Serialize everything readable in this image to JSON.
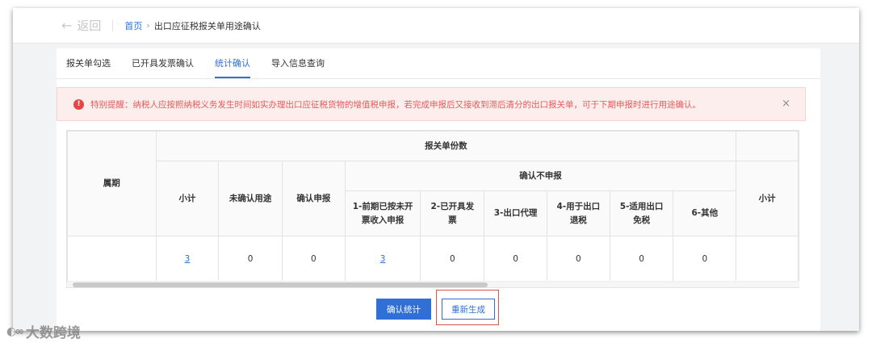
{
  "topbar": {
    "back_label": "返回",
    "breadcrumb_home": "首页",
    "breadcrumb_current": "出口应征税报关单用途确认"
  },
  "tabs": [
    {
      "label": "报关单勾选",
      "active": false
    },
    {
      "label": "已开具发票确认",
      "active": false
    },
    {
      "label": "统计确认",
      "active": true
    },
    {
      "label": "导入信息查询",
      "active": false
    }
  ],
  "alert": {
    "text": "特别提醒：纳税人应按照纳税义务发生时间如实办理出口应征税货物的增值税申报，若完成申报后又接收到滞后清分的出口报关单，可于下期申报时进行用途确认。",
    "close_symbol": "×",
    "color": "#e65a5a"
  },
  "table": {
    "period_header": "属期",
    "group_header": "报关单份数",
    "subtotal_header": "小计",
    "unconfirmed_header": "未确认用途",
    "confirm_declare_header": "确认申报",
    "not_declare_header": "确认不申报",
    "reasons": [
      "1-前期已按未开票收入申报",
      "2-已开具发票",
      "3-出口代理",
      "4-用于出口退税",
      "5-适用出口免税",
      "6-其他"
    ],
    "right_subtotal_header": "小计",
    "row": {
      "period": "",
      "subtotal": "3",
      "unconfirmed": "0",
      "confirm_declare": "0",
      "r1": "3",
      "r2": "0",
      "r3": "0",
      "r4": "0",
      "r5": "0",
      "r6": "0",
      "right_subtotal": ""
    }
  },
  "buttons": {
    "confirm_stats": "确认统计",
    "regenerate": "重新生成"
  },
  "watermark": {
    "text": "大数跨境"
  },
  "colors": {
    "accent": "#2f6fd6",
    "alert_bg": "#fdeeee",
    "highlight_border": "#d9534f"
  }
}
